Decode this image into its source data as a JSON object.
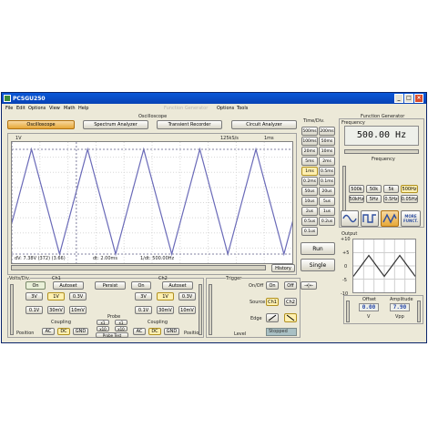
{
  "window": {
    "title": "PCSGU250"
  },
  "menu": [
    "File",
    "Edit",
    "Options",
    "View",
    "Math",
    "Help"
  ],
  "menu_right": [
    "Options",
    "Tools"
  ],
  "section_labels": {
    "oscilloscope": "Oscilloscope",
    "function_generator_faded": "Function Generator",
    "function_generator": "Function Generator"
  },
  "tabs": [
    {
      "label": "Oscilloscope",
      "active": true
    },
    {
      "label": "Spectrum Analyzer",
      "active": false
    },
    {
      "label": "Transient Recorder",
      "active": false
    },
    {
      "label": "Circuit Analyzer",
      "active": false
    }
  ],
  "scope": {
    "ch_label": "1V",
    "sample_rate": "125kS/s",
    "time_label": "1ms",
    "readout_dv": "dV: 7.38V  (372) (3.66)",
    "readout_dt": "dt: 2.00ms",
    "readout_freq": "1/dt: 500.00Hz",
    "history_button": "History"
  },
  "time_div": {
    "title": "Time/Div.",
    "buttons": [
      [
        "500ms",
        "200ms"
      ],
      [
        "100ms",
        "50ms"
      ],
      [
        "20ms",
        "10ms"
      ],
      [
        "5ms",
        "2ms"
      ],
      [
        "1ms",
        "0.5ms"
      ],
      [
        "0.2ms",
        "0.1ms"
      ],
      [
        "50us",
        "20us"
      ],
      [
        "10us",
        "5us"
      ],
      [
        "2us",
        "1us"
      ],
      [
        "0.5us",
        "0.2us"
      ],
      [
        "0.1us",
        ""
      ]
    ],
    "selected": "1ms",
    "run_button": "Run",
    "single_button": "Single"
  },
  "generator": {
    "frequency_label": "Frequency",
    "frequency_display": "500.00 Hz",
    "freq_title": "Frequency",
    "range_row1": [
      "500k",
      "50k",
      "5k",
      "500Hz"
    ],
    "range_row2": [
      "50kHz",
      "5Hz",
      "0.5Hz",
      "0.05Hz"
    ],
    "range_selected": "500Hz",
    "waveforms": [
      "sine-wave-icon",
      "square-wave-icon",
      "triangle-wave-icon"
    ],
    "waveform_selected": "triangle-wave-icon",
    "more_funct": "MORE FUNCT.",
    "output_label": "Output",
    "output_y_ticks": [
      "+10",
      "+5",
      "0",
      "-5",
      "-10"
    ],
    "offset_label": "Offset",
    "offset_value": "0.00",
    "offset_unit": "V",
    "amplitude_label": "Amplitude",
    "amplitude_value": "7.90",
    "amplitude_unit": "Vpp"
  },
  "ch1": {
    "title": "Ch1",
    "volts_div": "Volts/Div.",
    "on": "On",
    "autoset": "Autoset",
    "volts": [
      "3V",
      "1V",
      "0.3V",
      "0.1V",
      "30mV",
      "10mV"
    ],
    "selected": "1V",
    "coupling": "Coupling",
    "coupling_opts": [
      "AC",
      "DC",
      "GND"
    ],
    "coupling_selected": "DC",
    "position": "Position"
  },
  "persist": "Persist",
  "probe": {
    "title": "Probe",
    "opts": [
      "x1",
      "x1",
      "x10",
      "x10"
    ],
    "test": "Probe Test"
  },
  "ch2": {
    "title": "Ch2",
    "on": "On",
    "autoset": "Autoset",
    "volts": [
      "3V",
      "1V",
      "0.3V",
      "0.1V",
      "30mV",
      "10mV"
    ],
    "selected": "1V",
    "coupling": "Coupling",
    "coupling_opts": [
      "AC",
      "DC",
      "GND"
    ],
    "coupling_selected": "DC",
    "position": "Position"
  },
  "trigger": {
    "title": "Trigger",
    "onoff_label": "On/Off",
    "on": "On",
    "off": "Off",
    "source_label": "Source",
    "source_opts": [
      "Ch1",
      "Ch2"
    ],
    "source_selected": "Ch1",
    "edge_label": "Edge",
    "level_label": "Level",
    "status": "Stopped"
  },
  "colors": {
    "trace": "#6a6ab8",
    "active_button": "#e6a838",
    "titlebar": "#0a58d8"
  }
}
